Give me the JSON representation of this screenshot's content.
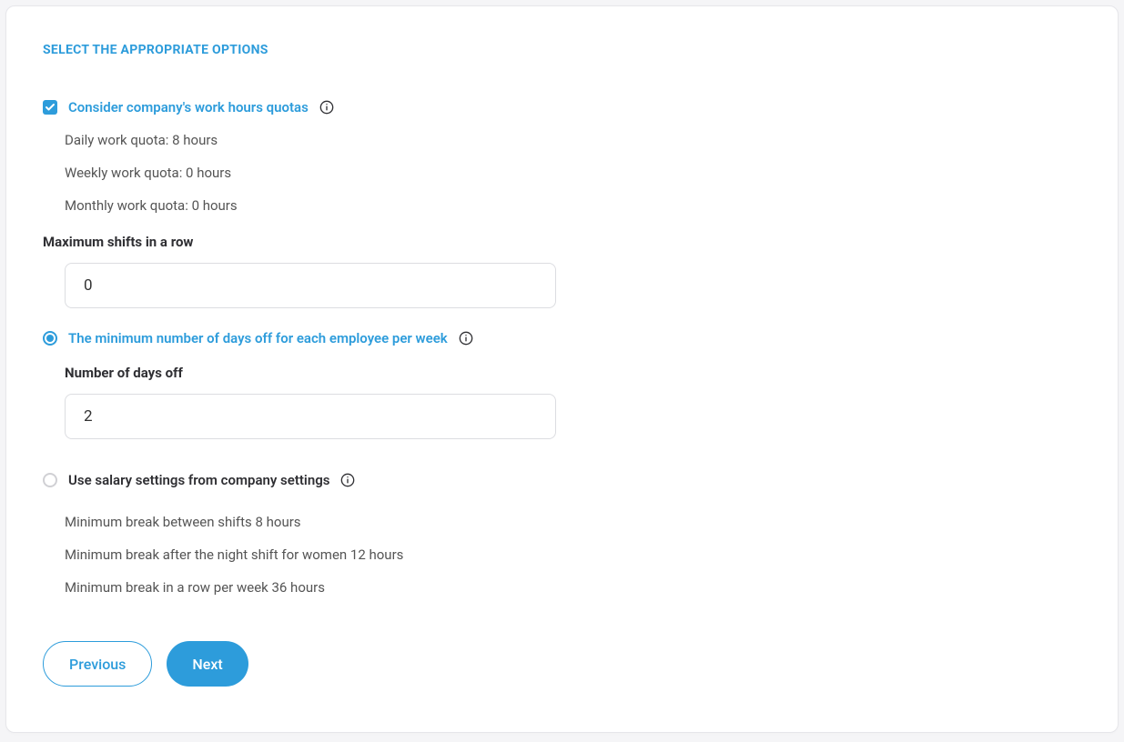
{
  "title": "SELECT THE APPROPRIATE OPTIONS",
  "options": {
    "work_hours": {
      "label": "Consider company's work hours quotas",
      "quotas": {
        "daily": "Daily work quota: 8 hours",
        "weekly": "Weekly work quota: 0 hours",
        "monthly": "Monthly work quota: 0 hours"
      }
    },
    "max_shifts": {
      "label": "Maximum shifts in a row",
      "value": "0"
    },
    "min_days_off": {
      "label": "The minimum number of days off for each employee per week",
      "field_label": "Number of days off",
      "value": "2"
    },
    "salary": {
      "label": "Use salary settings from company settings",
      "breaks": {
        "between": "Minimum break between shifts 8 hours",
        "night_women": "Minimum break after the night shift for women 12 hours",
        "per_week": "Minimum break in a row per week 36 hours"
      }
    }
  },
  "buttons": {
    "previous": "Previous",
    "next": "Next"
  }
}
